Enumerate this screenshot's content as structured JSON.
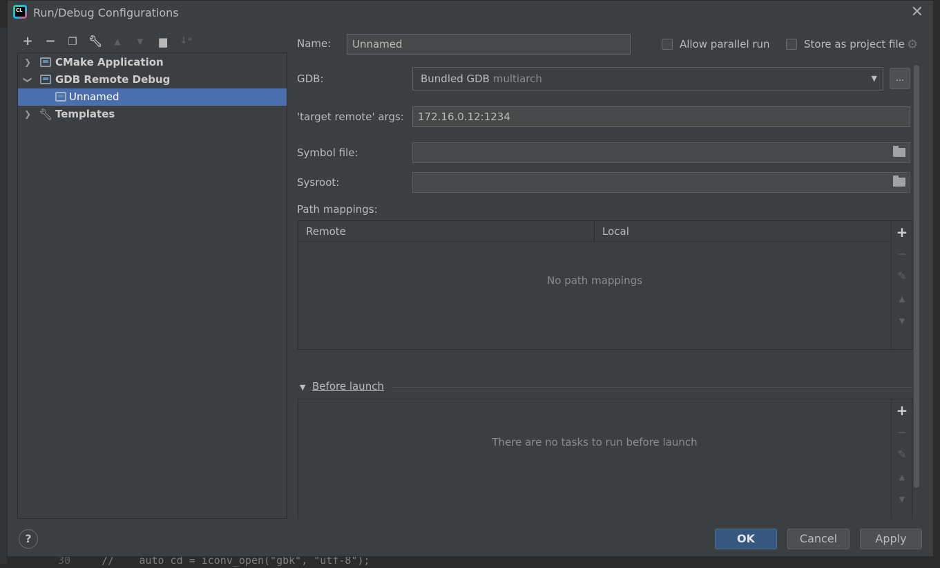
{
  "background": {
    "code_line_number": "30",
    "code_text": "//    auto cd = iconv_open(\"gbk\", \"utf-8\");"
  },
  "window": {
    "title": "Run/Debug Configurations",
    "app_icon_text": "CL"
  },
  "toolbar": {
    "icons": [
      "add-icon",
      "remove-icon",
      "copy-icon",
      "wrench-icon",
      "move-up-icon",
      "move-down-icon",
      "new-folder-icon",
      "sort-icon"
    ]
  },
  "tree": {
    "items": [
      {
        "label": "CMake Application",
        "expanded": false
      },
      {
        "label": "GDB Remote Debug",
        "expanded": true
      },
      {
        "label": "Unnamed",
        "selected": true
      },
      {
        "label": "Templates",
        "expanded": false
      }
    ]
  },
  "form": {
    "name_label": "Name:",
    "name_value": "Unnamed",
    "allow_parallel_label": "Allow parallel run",
    "store_project_label": "Store as project file",
    "gdb_label": "GDB:",
    "gdb_value": "Bundled GDB",
    "gdb_hint": "multiarch",
    "gdb_browse_label": "...",
    "target_label": "'target remote' args:",
    "target_value": "172.16.0.12:1234",
    "symbol_label": "Symbol file:",
    "symbol_value": "",
    "sysroot_label": "Sysroot:",
    "sysroot_value": "",
    "path_mappings_label": "Path mappings:",
    "path_mappings": {
      "columns": [
        "Remote",
        "Local"
      ],
      "rows": [],
      "empty_text": "No path mappings"
    },
    "before_launch": {
      "title": "Before launch",
      "empty_text": "There are no tasks to run before launch"
    }
  },
  "footer": {
    "help_label": "?",
    "ok_label": "OK",
    "cancel_label": "Cancel",
    "apply_label": "Apply"
  },
  "colors": {
    "selection": "#4b6eaf",
    "primary_button": "#365880",
    "dialog_bg": "#3c3f41"
  }
}
